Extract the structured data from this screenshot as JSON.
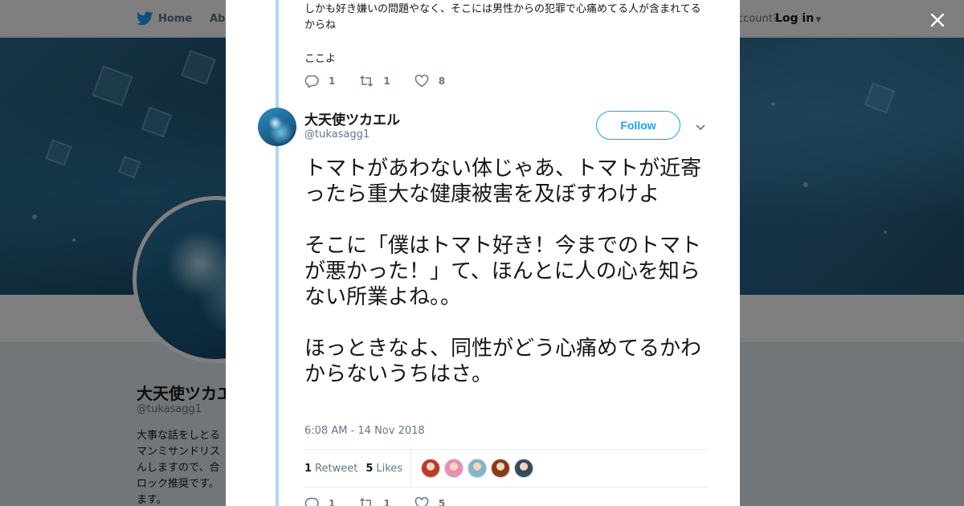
{
  "topbar": {
    "home_label": "Home",
    "about_label": "Abo",
    "account_prompt": "ccount?",
    "login_label": "Log in"
  },
  "profile": {
    "name": "大天使ツカエ",
    "handle": "@tukasagg1",
    "bio": "大事な話をしとるマンミサンドリスんしますので、合ロック推奨です。ます。"
  },
  "previous_tweet": {
    "text": "しかも好き嫌いの問題やなく、そこには男性からの犯罪で心痛めてる人が含まれてるからね",
    "text2": "ここよ",
    "replies": "1",
    "retweets": "1",
    "likes": "8"
  },
  "tweet": {
    "author_name": "大天使ツカエル",
    "author_handle": "@tukasagg1",
    "follow_label": "Follow",
    "text": "トマトがあわない体じゃあ、トマトが近寄ったら重大な健康被害を及ぼすわけよ\n\nそこに「僕はトマト好き！今までのトマトが悪かった！」て、ほんとに人の心を知らない所業よね。。\n\nほっときなよ、同性がどう心痛めてるかわからないうちはさ。",
    "timestamp": "6:08 AM - 14 Nov 2018",
    "retweet_count": "1",
    "retweet_label": "Retweet",
    "like_count": "5",
    "like_label": "Likes",
    "replies": "1",
    "retweets": "1",
    "likes": "5"
  },
  "liker_faces": [
    {
      "color": "#c0392b"
    },
    {
      "color": "#e78fb3"
    },
    {
      "color": "#7fb7c9"
    },
    {
      "color": "#8b3a12"
    },
    {
      "color": "#34495e"
    }
  ],
  "colors": {
    "accent": "#1da1f2",
    "thread_line": "#a9d8f5",
    "text_primary": "#14171a",
    "text_secondary": "#657786"
  }
}
